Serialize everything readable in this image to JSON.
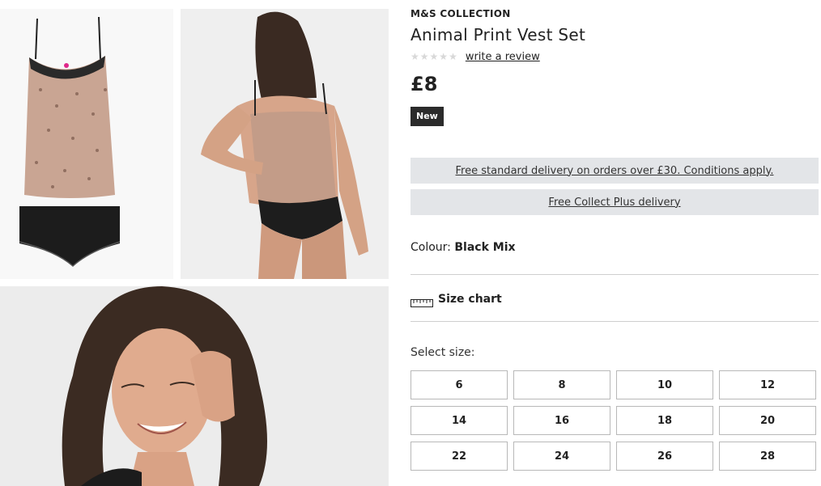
{
  "product": {
    "brand": "M&S COLLECTION",
    "title": "Animal Print Vest Set",
    "review_link": "write a review",
    "rating_star_count": 5,
    "price": "£8",
    "badge": "New"
  },
  "delivery": {
    "standard": "Free standard delivery on orders over £30. Conditions apply.",
    "collect_plus": "Free Collect Plus delivery"
  },
  "colour": {
    "label": "Colour:",
    "value": "Black Mix"
  },
  "size_chart": {
    "label": "Size chart",
    "icon": "ruler-icon"
  },
  "sizes": {
    "label": "Select size:",
    "options": [
      "6",
      "8",
      "10",
      "12",
      "14",
      "16",
      "18",
      "20",
      "22",
      "24",
      "26",
      "28"
    ]
  },
  "gallery": {
    "images": [
      "product-flatlay-image",
      "model-back-view-image",
      "model-closeup-image"
    ]
  },
  "colors": {
    "banner_bg": "#e3e5e8",
    "badge_bg": "#2b2b2b",
    "star_empty": "#d8d8d8"
  }
}
